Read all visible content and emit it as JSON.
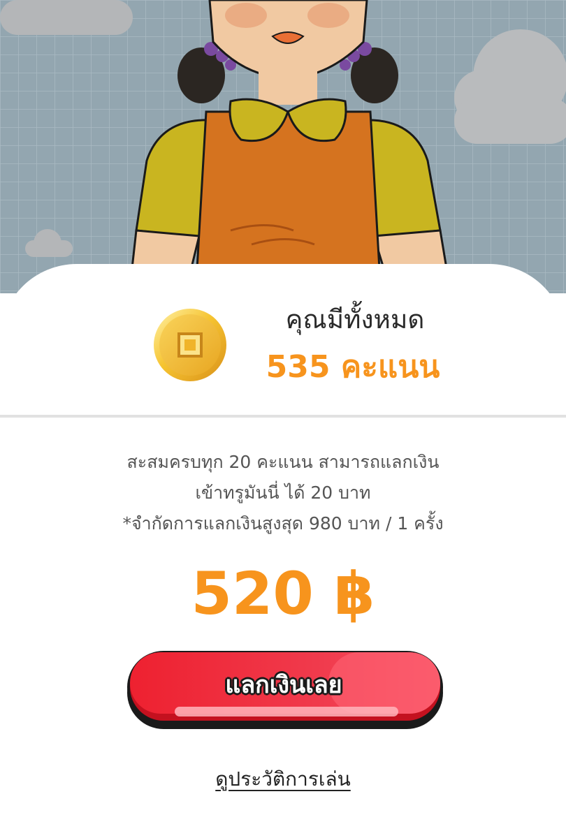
{
  "balance": {
    "label": "คุณมีทั้งหมด",
    "points": "535 คะแนน"
  },
  "info": {
    "line1": "สะสมครบทุก 20 คะแนน สามารถแลกเงิน",
    "line2": "เข้าทรูมันนี่ ได้ 20 บาท",
    "line3": "*จำกัดการแลกเงินสูงสุด 980 บาท / 1 ครั้ง"
  },
  "redeem": {
    "amount": "520 ฿",
    "button_label": "แลกเงินเลย"
  },
  "history_link": "ดูประวัติการเล่น",
  "colors": {
    "accent": "#f7941d",
    "button": "#ee2b3c",
    "hero_background": "#8fa3ad"
  },
  "icons": {
    "coin": "gold-coin-icon"
  }
}
